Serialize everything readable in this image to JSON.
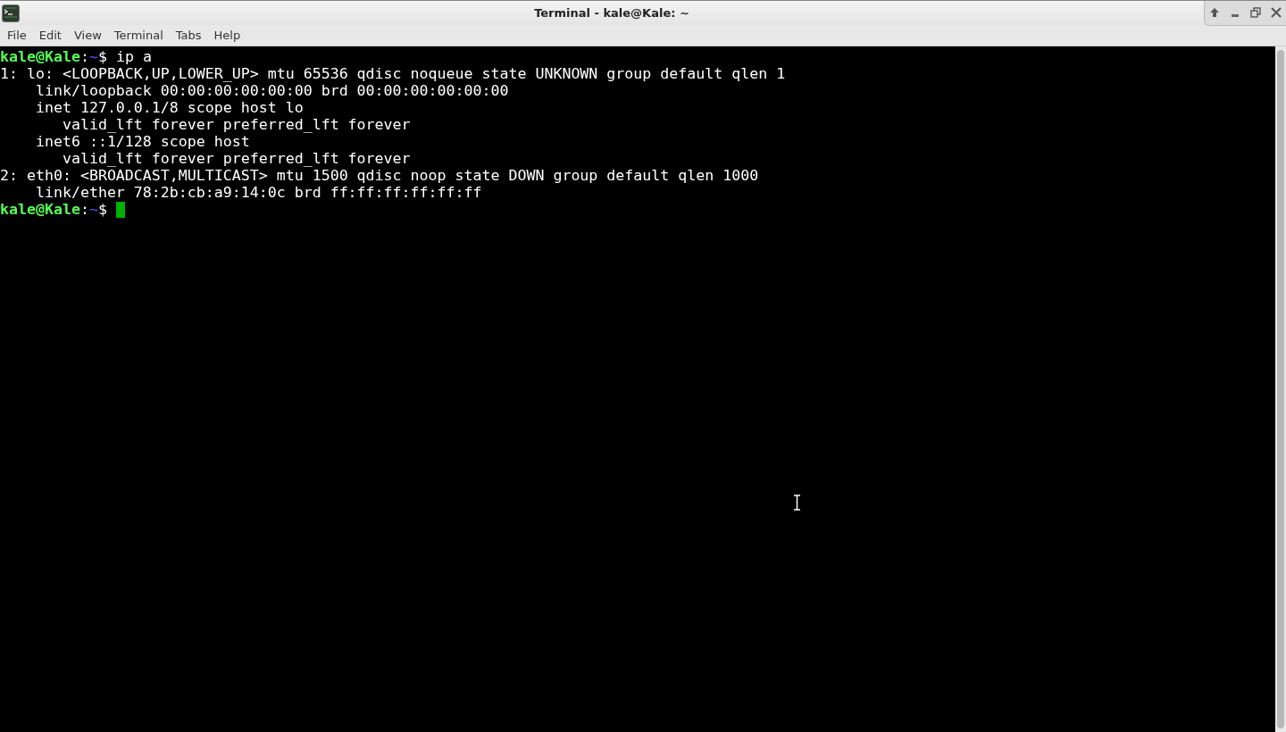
{
  "window": {
    "title": "Terminal - kale@Kale: ~"
  },
  "menu": [
    "File",
    "Edit",
    "View",
    "Terminal",
    "Tabs",
    "Help"
  ],
  "lines": [
    {
      "kind": "prompt",
      "user": "kale@Kale",
      "sep": ":",
      "path": "~",
      "symbol": "$",
      "command": "ip a",
      "cursor": false
    },
    {
      "kind": "output",
      "text": "1: lo: <LOOPBACK,UP,LOWER_UP> mtu 65536 qdisc noqueue state UNKNOWN group default qlen 1"
    },
    {
      "kind": "output",
      "text": "    link/loopback 00:00:00:00:00:00 brd 00:00:00:00:00:00"
    },
    {
      "kind": "output",
      "text": "    inet 127.0.0.1/8 scope host lo"
    },
    {
      "kind": "output",
      "text": "       valid_lft forever preferred_lft forever"
    },
    {
      "kind": "output",
      "text": "    inet6 ::1/128 scope host"
    },
    {
      "kind": "output",
      "text": "       valid_lft forever preferred_lft forever"
    },
    {
      "kind": "output",
      "text": "2: eth0: <BROADCAST,MULTICAST> mtu 1500 qdisc noop state DOWN group default qlen 1000"
    },
    {
      "kind": "output",
      "text": "    link/ether 78:2b:cb:a9:14:0c brd ff:ff:ff:ff:ff:ff"
    },
    {
      "kind": "prompt",
      "user": "kale@Kale",
      "sep": ":",
      "path": "~",
      "symbol": "$",
      "cursor": true
    }
  ]
}
